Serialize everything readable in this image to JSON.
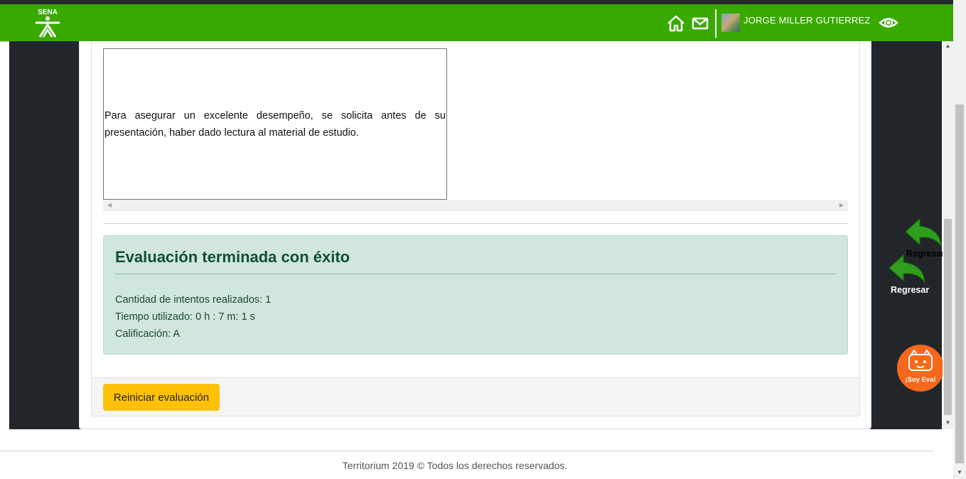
{
  "header": {
    "username": "JORGE MILLER GUTIERREZ",
    "logo_text": "SENA",
    "icons": [
      "home-icon",
      "mail-icon",
      "eye-icon"
    ]
  },
  "content": {
    "instruction_text": "Para asegurar un excelente desempeño, se solicita antes de su presentación, haber dado lectura al material de estudio."
  },
  "result": {
    "title": "Evaluación terminada con éxito",
    "attempts": "Cantidad de intentos realizados: 1",
    "time_used": "Tiempo utilizado: 0 h : 7 m: 1 s",
    "grade": "Calificación: A"
  },
  "actions": {
    "restart_label": "Reiniciar evaluación",
    "back_label_1": "Regresar",
    "back_label_2": "Regresar",
    "eva_label": "¡Soy Eva!"
  },
  "footer": {
    "copyright": "Territorium 2019 © Todos los derechos reservados."
  },
  "colors": {
    "header_green": "#39a900",
    "alert_bg": "#d1e6dd",
    "alert_text": "#0f5132",
    "button_yellow": "#ffc107",
    "eva_orange": "#f7681c",
    "arrow_green": "#2e9e1c"
  }
}
